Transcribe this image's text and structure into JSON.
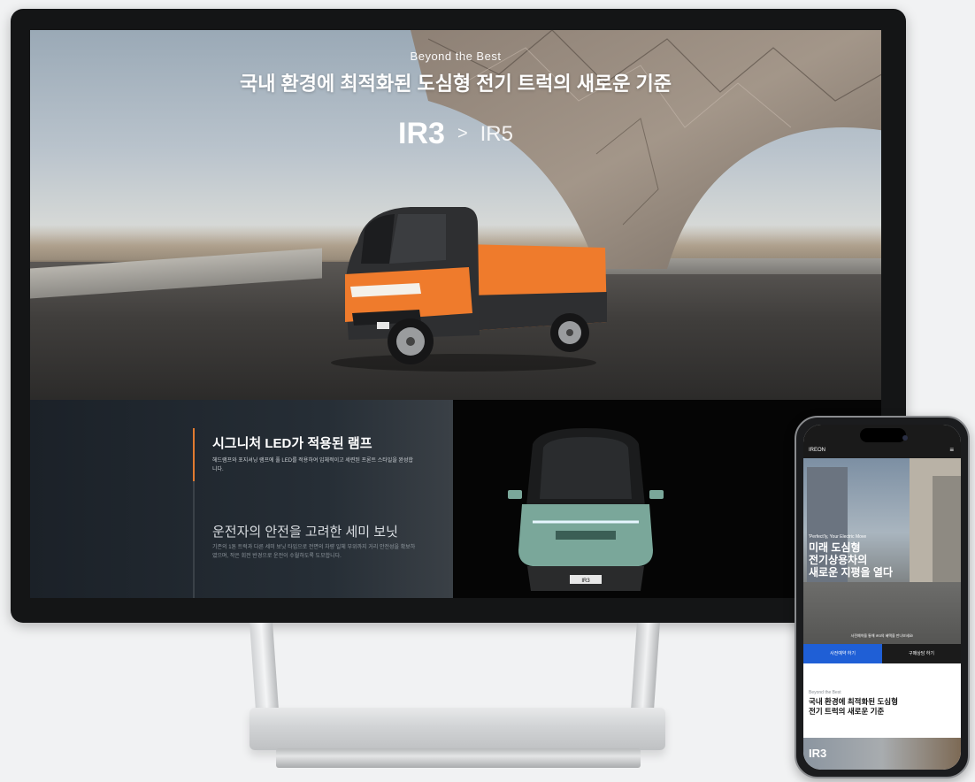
{
  "desktop": {
    "hero": {
      "subtitle": "Beyond the Best",
      "title": "국내 환경에 최적화된 도심형 전기 트럭의 새로운 기준",
      "models": {
        "active": "IR3",
        "separator": ">",
        "other": "IR5"
      },
      "plate": "IR3"
    },
    "features": [
      {
        "title": "시그니처 LED가 적용된 램프",
        "desc": "헤드램프와 포지셔닝 램프에 풀 LED를 적용하여 입체적이고 세련된 프론트 스타일을 완성합니다."
      },
      {
        "title": "운전자의 안전을 고려한 세미 보닛",
        "desc": "기존의 1톤 트럭과 다른 세미 보닛 타입으로 전면의 차량 일체 부위까지 거리 안전성을 확보하였으며, 작은 회전 반경으로 운전이 수월하도록 도모합니다."
      }
    ],
    "front_plate": "IR3"
  },
  "mobile": {
    "logo": "IREON",
    "menu_icon": "≡",
    "hero_tag": "'Perfect'ly, Your Electric Move",
    "hero_title_1": "미래 도심형",
    "hero_title_2": "전기상용차의",
    "hero_title_3": "새로운 지평을 열다",
    "hero_note": "사전예약을 통해 IR3의 혜택을 만나보세요!",
    "btn_reserve": "사전예약 하기",
    "btn_consult": "구매상담 하기",
    "section_sub": "Beyond the Best",
    "section_title_1": "국내 환경에 최적화된 도심형",
    "section_title_2": "전기 트럭의 새로운 기준",
    "model": "IR3"
  },
  "colors": {
    "accent_orange": "#e07a30",
    "button_blue": "#1f5fd6",
    "truck_orange": "#ef7b2c",
    "truck_mint": "#7aa79a"
  }
}
